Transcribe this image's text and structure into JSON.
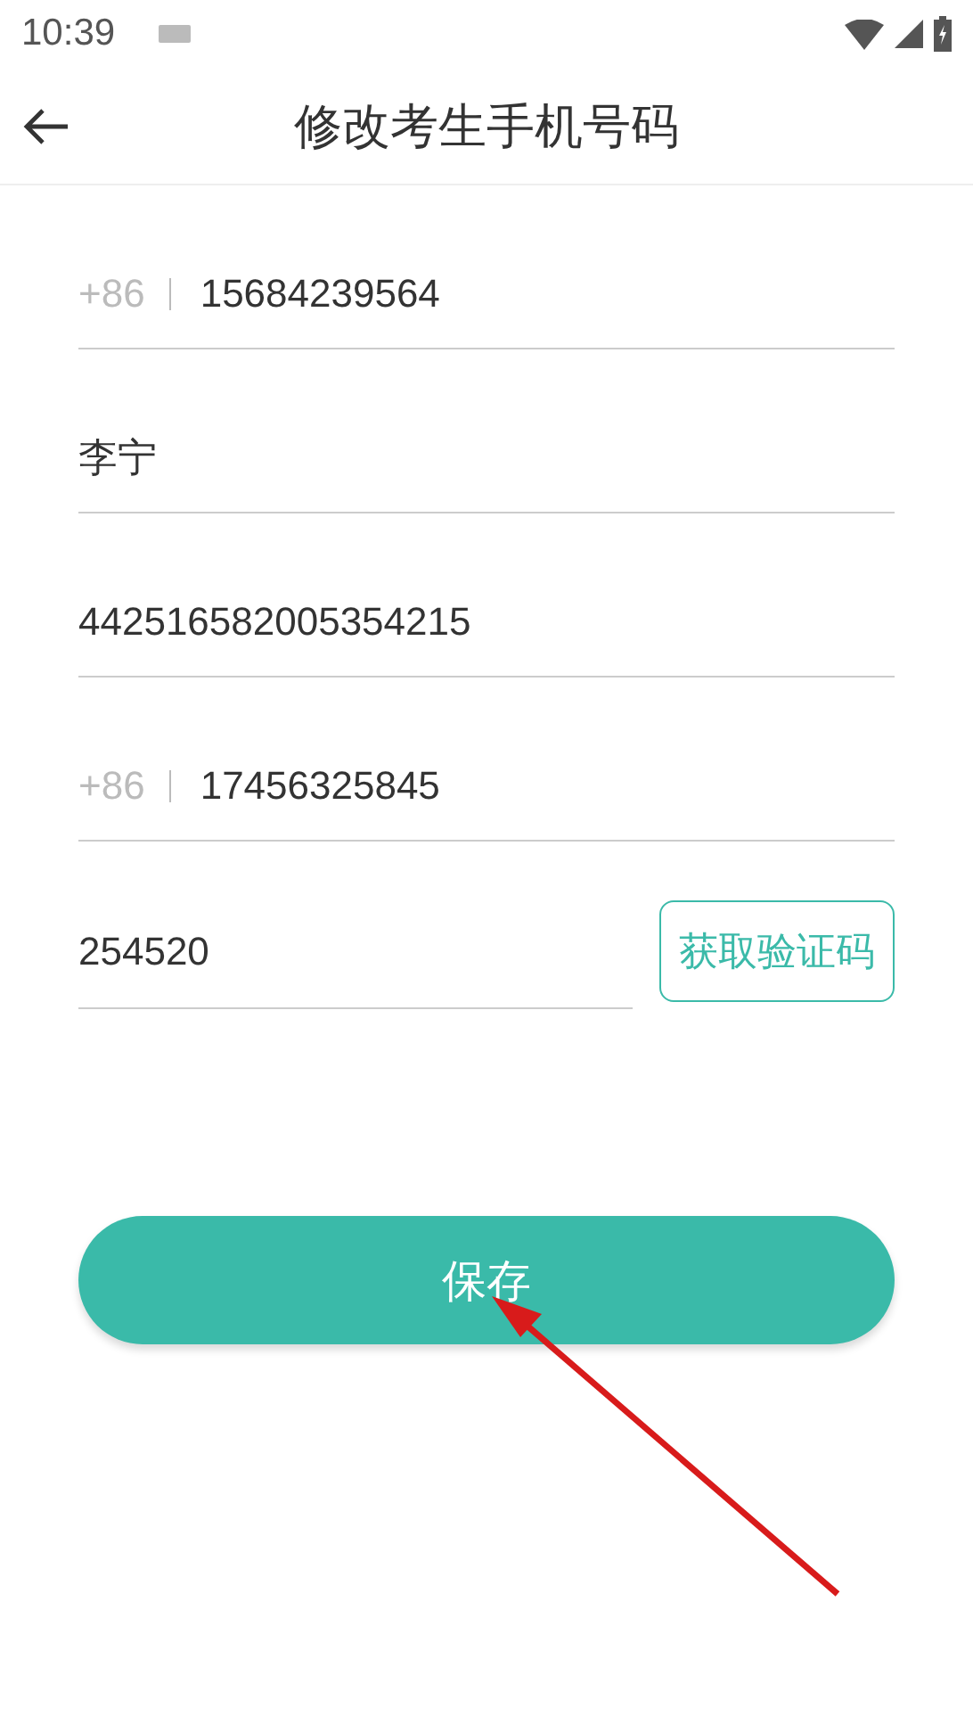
{
  "status_bar": {
    "time": "10:39"
  },
  "header": {
    "title": "修改考生手机号码"
  },
  "fields": [
    {
      "kind": "phone",
      "prefix": "+86",
      "value": "15684239564"
    },
    {
      "kind": "text",
      "value": "李宁"
    },
    {
      "kind": "text",
      "value": "442516582005354215"
    },
    {
      "kind": "phone",
      "prefix": "+86",
      "value": "17456325845"
    }
  ],
  "code": {
    "value": "254520",
    "button": "获取验证码"
  },
  "save_button": "保存"
}
